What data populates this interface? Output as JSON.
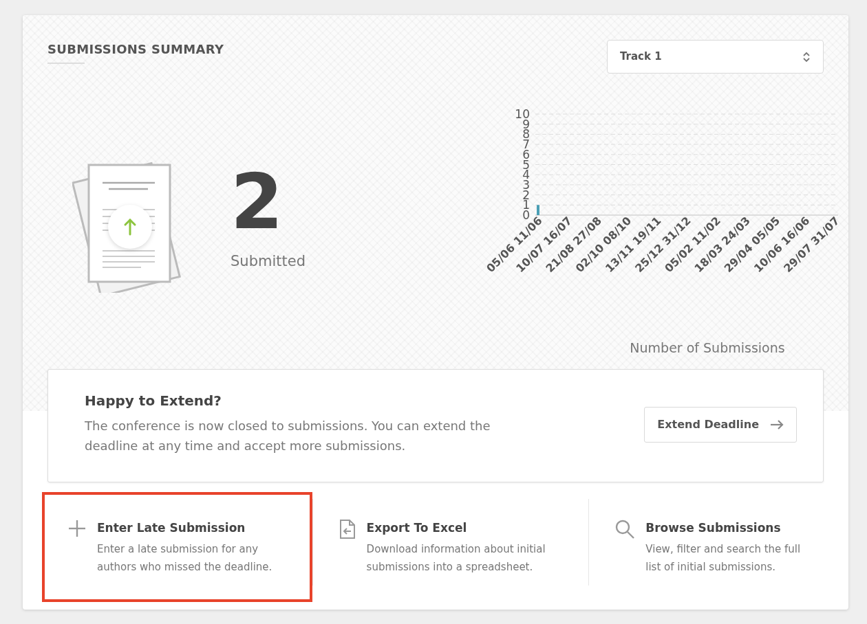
{
  "header": {
    "title": "SUBMISSIONS SUMMARY",
    "track_select": {
      "value": "Track 1"
    }
  },
  "summary": {
    "count": "2",
    "label": "Submitted"
  },
  "chart": {
    "chart_data": {
      "type": "bar",
      "xlabel": "Number of Submissions",
      "categories": [
        "05/06 11/06",
        "10/07 16/07",
        "21/08 27/08",
        "02/10 08/10",
        "13/11 19/11",
        "25/12 31/12",
        "05/02 11/02",
        "18/03 24/03",
        "29/04 05/05",
        "10/06 16/06",
        "29/07 31/07"
      ],
      "grid": true,
      "series": [
        {
          "color": "#4a9fb5",
          "values": [
            1,
            0,
            0,
            0,
            0,
            0,
            0,
            0,
            0,
            0,
            0
          ]
        }
      ],
      "ylim": [
        0,
        10
      ],
      "yticks": [
        0,
        1,
        2,
        3,
        4,
        5,
        6,
        7,
        8,
        9,
        10
      ]
    }
  },
  "notice": {
    "title": "Happy to Extend?",
    "text": "The conference is now closed to submissions. You can extend the deadline at any time and accept more submissions.",
    "button": "Extend Deadline"
  },
  "actions": [
    {
      "kind": "plus",
      "title": "Enter Late Submission",
      "text": "Enter a late submission for any authors who missed the deadline.",
      "highlighted": true
    },
    {
      "kind": "export",
      "title": "Export To Excel",
      "text": "Download information about initial submissions into a spreadsheet.",
      "highlighted": false
    },
    {
      "kind": "search",
      "title": "Browse Submissions",
      "text": "View, filter and search the full list of initial submissions.",
      "highlighted": false
    }
  ]
}
